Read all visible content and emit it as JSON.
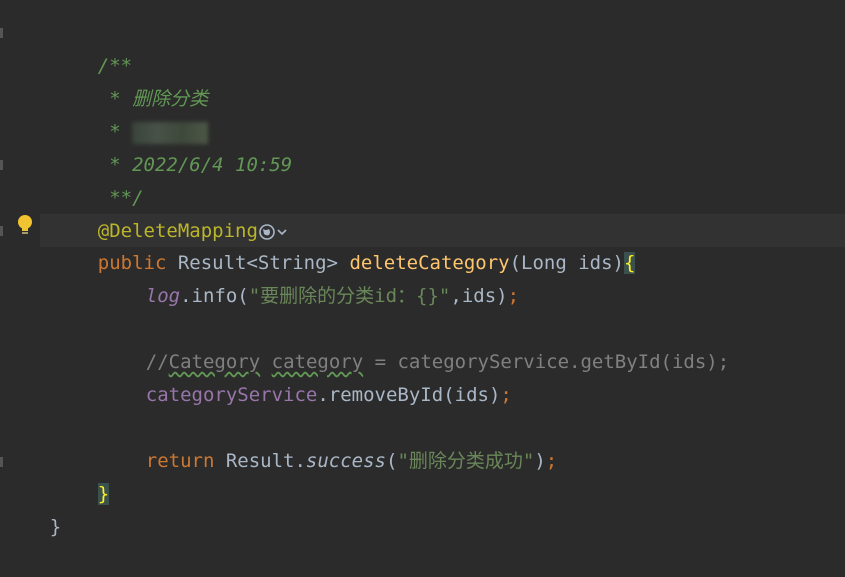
{
  "code": {
    "doc_open": "/**",
    "doc_line1": " * 删除分类",
    "doc_line2_prefix": " * ",
    "doc_line3": " * 2022/6/4 10:59",
    "doc_close": " **/",
    "annotation": "@DeleteMapping",
    "method_kw": "public",
    "method_type": " Result<String> ",
    "method_name": "deleteCategory",
    "method_params": "(Long ids)",
    "method_brace": "{",
    "log_obj": "log",
    "log_call": ".info(",
    "log_str": "\"要删除的分类id：{}\"",
    "log_rest": ",ids)",
    "semi": ";",
    "comment_prefix": "//",
    "comment_word1": "Category",
    "comment_space": " ",
    "comment_word2": "category",
    "comment_rest": " = categoryService.getById(ids);",
    "service_field": "categoryService",
    "service_call": ".removeById(ids)",
    "return_kw": "return",
    "return_type": " Result.",
    "return_method": "success",
    "return_open": "(",
    "return_str": "\"删除分类成功\"",
    "return_close": ")",
    "close_method": "}",
    "close_class": "}"
  }
}
